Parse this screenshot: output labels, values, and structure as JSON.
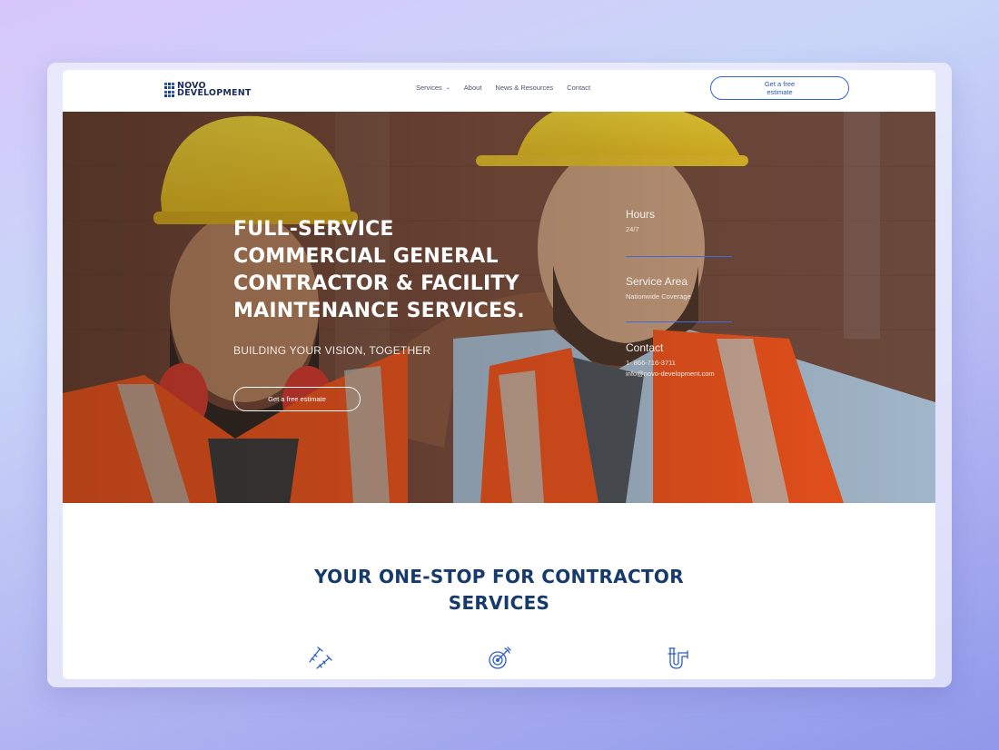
{
  "brand": {
    "logo_line1": "NOVO",
    "logo_line2": "DEVELOPMENT",
    "accent_color": "#3264d6",
    "heading_color": "#163a6b"
  },
  "nav": {
    "items": [
      {
        "label": "Services",
        "has_dropdown": true
      },
      {
        "label": "About"
      },
      {
        "label": "News & Resources"
      },
      {
        "label": "Contact"
      }
    ],
    "cta_label": "Get a free estimate"
  },
  "hero": {
    "title": "FULL-SERVICE COMMERCIAL GENERAL CONTRACTOR & FACILITY MAINTENANCE SERVICES.",
    "subtitle": "BUILDING YOUR VISION, TOGETHER",
    "button_label": "Get a free estimate",
    "hours": {
      "label": "Hours",
      "value": "24/7"
    },
    "service_area": {
      "label": "Service Area",
      "value": "Nationwide Coverage"
    },
    "contact": {
      "label": "Contact",
      "phone": "1- 866-716-3711",
      "email": "info@novo-development.com"
    }
  },
  "section": {
    "title_line1": "YOUR ONE-STOP FOR CONTRACTOR",
    "title_line2": "SERVICES",
    "icons": [
      "screws-icon",
      "target-icon",
      "pipe-icon"
    ]
  }
}
